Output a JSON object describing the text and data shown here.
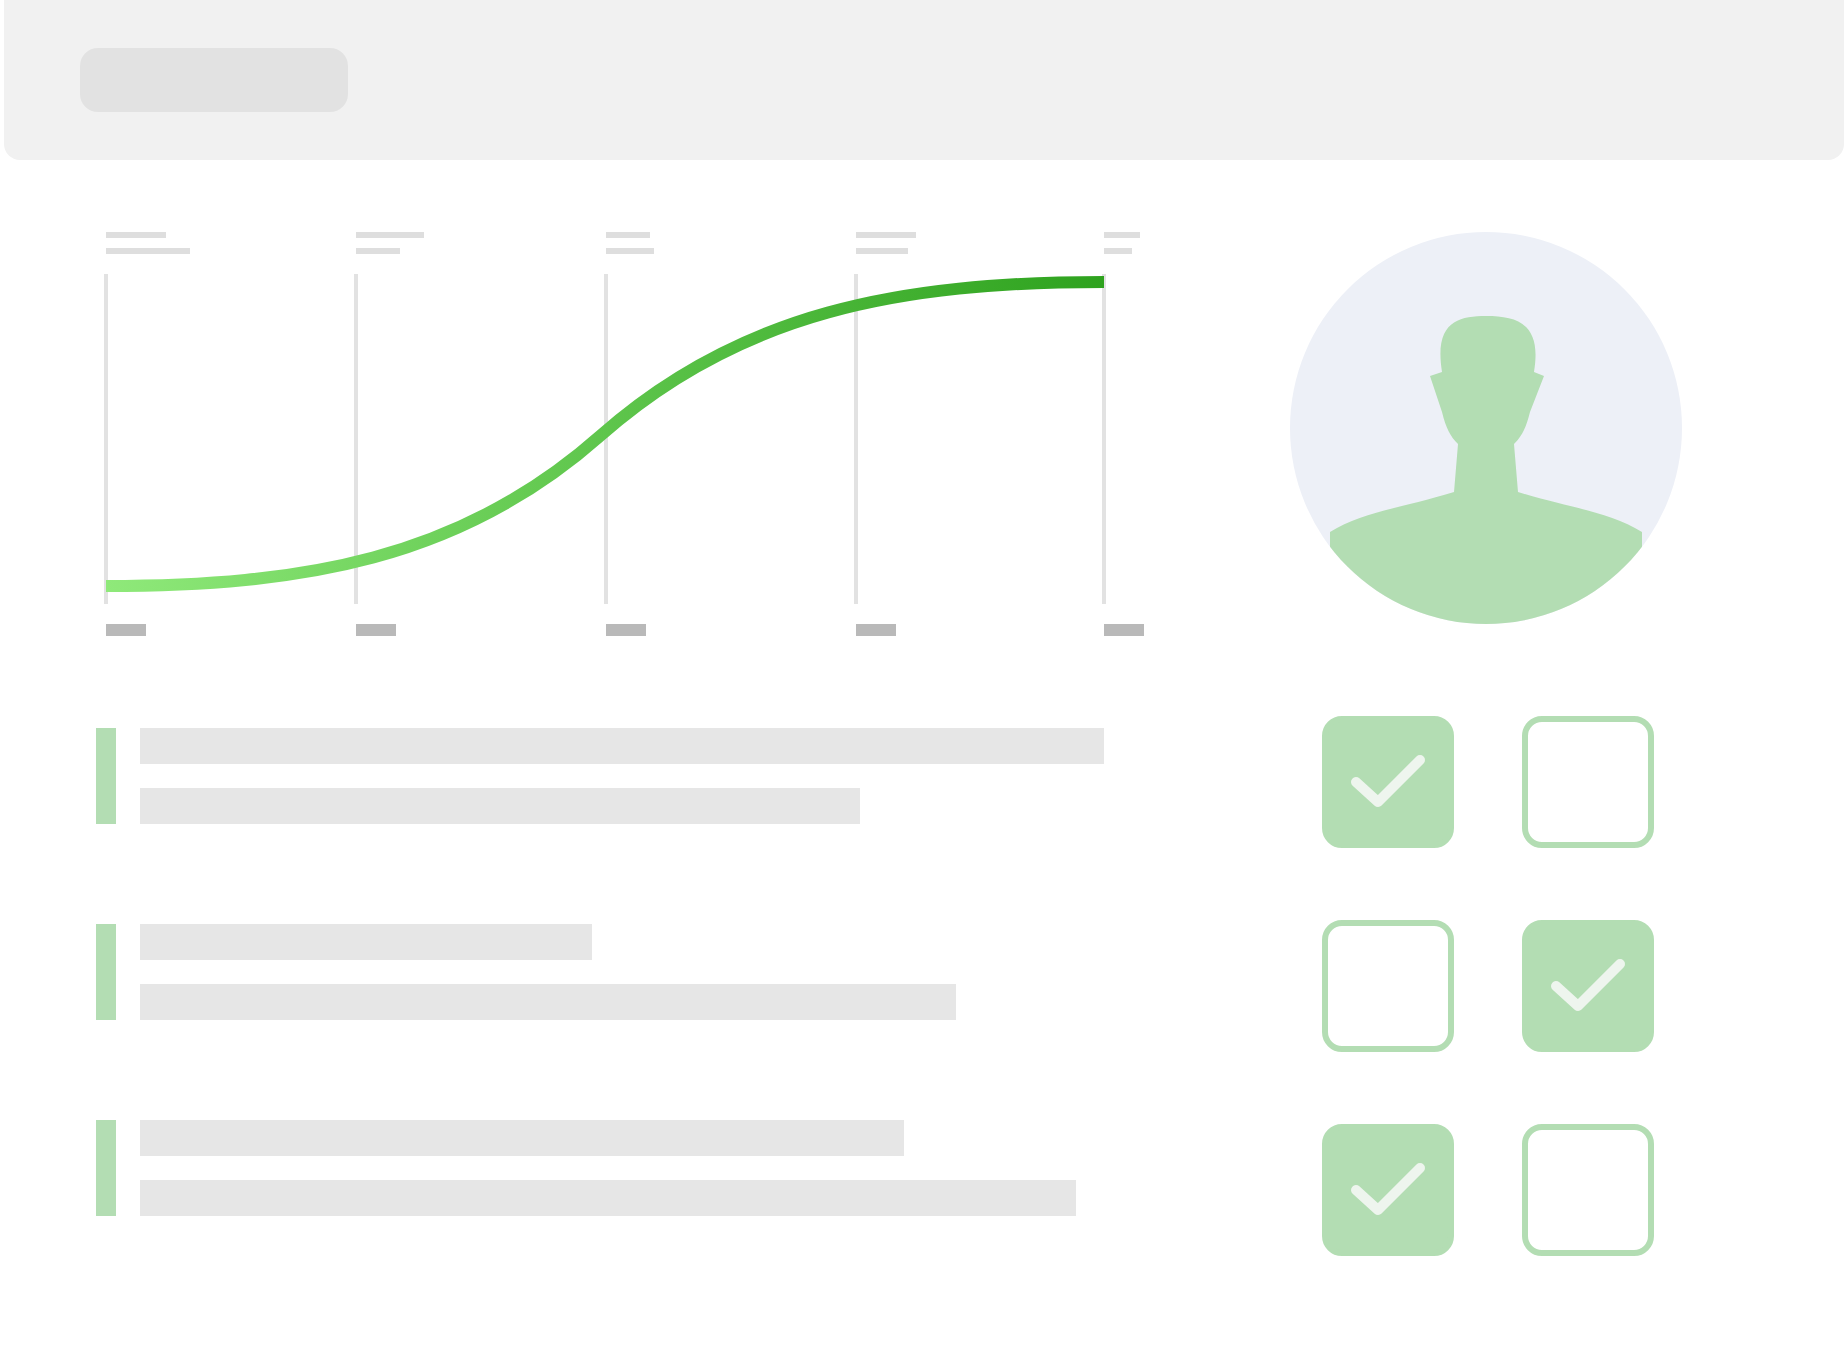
{
  "checkboxes": [
    {
      "checked": true
    },
    {
      "checked": false
    },
    {
      "checked": false
    },
    {
      "checked": true
    },
    {
      "checked": true
    },
    {
      "checked": false
    }
  ]
}
